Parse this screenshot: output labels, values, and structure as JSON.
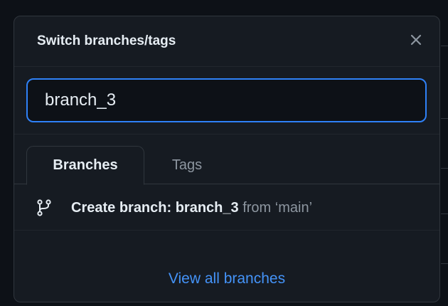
{
  "dialog": {
    "title": "Switch branches/tags",
    "close_icon": "close-icon"
  },
  "search": {
    "value": "branch_3",
    "placeholder": ""
  },
  "tabs": [
    {
      "label": "Branches",
      "selected": true
    },
    {
      "label": "Tags",
      "selected": false
    }
  ],
  "create_item": {
    "icon": "git-branch-icon",
    "prefix": "Create branch: ",
    "branch_name": "branch_3",
    "suffix": " from ‘main’"
  },
  "footer": {
    "link_label": "View all branches"
  },
  "colors": {
    "background": "#0d1117",
    "panel": "#161b22",
    "border": "#30363d",
    "accent": "#2f81f7",
    "link": "#4493f8",
    "text": "#e6edf3",
    "muted": "#8d96a0"
  }
}
